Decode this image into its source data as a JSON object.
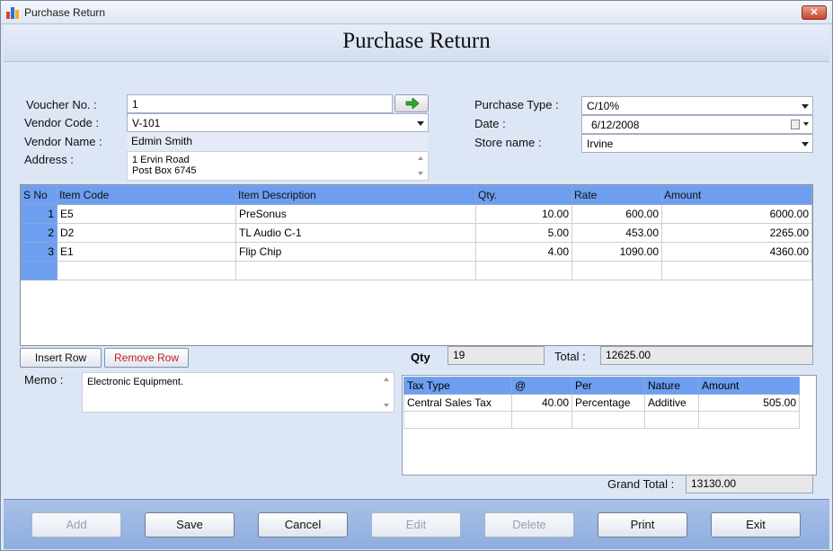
{
  "window": {
    "title": "Purchase Return"
  },
  "header": {
    "heading": "Purchase Return"
  },
  "form": {
    "voucher_label": "Voucher No. :",
    "voucher_value": "1",
    "vendor_code_label": "Vendor Code :",
    "vendor_code_value": "V-101",
    "vendor_name_label": "Vendor Name :",
    "vendor_name_value": "Edmin Smith",
    "address_label": "Address :",
    "address_line1": "1 Ervin Road",
    "address_line2": "Post Box 6745",
    "purchase_type_label": "Purchase Type :",
    "purchase_type_value": "C/10%",
    "date_label": "Date :",
    "date_value": "6/12/2008",
    "store_label": "Store name :",
    "store_value": "Irvine"
  },
  "grid": {
    "columns": [
      "S No",
      "Item Code",
      "Item Description",
      "Qty.",
      "Rate",
      "Amount"
    ],
    "rows": [
      {
        "sno": "1",
        "code": "E5",
        "desc": "PreSonus",
        "qty": "10.00",
        "rate": "600.00",
        "amount": "6000.00"
      },
      {
        "sno": "2",
        "code": "D2",
        "desc": "TL Audio C-1",
        "qty": "5.00",
        "rate": "453.00",
        "amount": "2265.00"
      },
      {
        "sno": "3",
        "code": "E1",
        "desc": "Flip Chip",
        "qty": "4.00",
        "rate": "1090.00",
        "amount": "4360.00"
      }
    ]
  },
  "row_buttons": {
    "insert_label": "Insert Row",
    "remove_label": "Remove Row"
  },
  "totals": {
    "qty_label": "Qty",
    "qty_value": "19",
    "total_label": "Total :",
    "total_value": "12625.00"
  },
  "memo": {
    "label": "Memo :",
    "value": "Electronic Equipment."
  },
  "tax": {
    "columns": [
      "Tax Type",
      "@",
      "Per",
      "Nature",
      "Amount"
    ],
    "rows": [
      {
        "type": "Central Sales Tax",
        "at": "40.00",
        "per": "Percentage",
        "nature": "Additive",
        "amount": "505.00"
      }
    ]
  },
  "grand_total": {
    "label": "Grand Total :",
    "value": "13130.00"
  },
  "footer": {
    "add_label": "Add",
    "save_label": "Save",
    "cancel_label": "Cancel",
    "edit_label": "Edit",
    "delete_label": "Delete",
    "print_label": "Print",
    "exit_label": "Exit"
  },
  "colors": {
    "grid_header": "#6d9ef0",
    "footer_bg": "#9bb6e3",
    "remove_text": "#c0202a",
    "go_arrow": "#2fa82f"
  }
}
